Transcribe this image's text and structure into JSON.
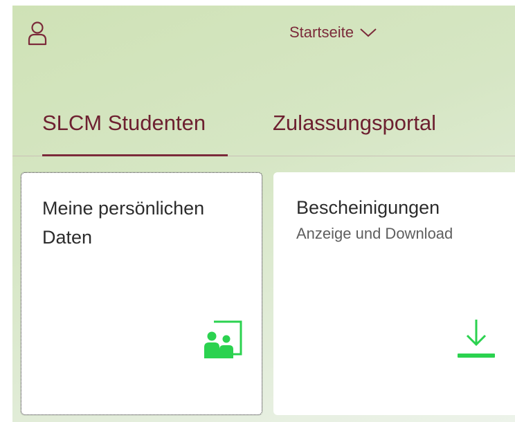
{
  "header": {
    "user_icon": "person-icon",
    "app_title": "Startseite",
    "title_menu_icon": "chevron-down-icon"
  },
  "tabs": [
    {
      "label": "SLCM Studenten",
      "selected": true
    },
    {
      "label": "Zulassungsportal",
      "selected": false
    }
  ],
  "tiles": [
    {
      "title": "Meine persönlichen Daten",
      "subtitle": "",
      "icon": "people-presentation-icon"
    },
    {
      "title": "Bescheinigungen",
      "subtitle": "Anzeige und Download",
      "icon": "download-icon"
    }
  ],
  "colors": {
    "brand": "#7b2a3a",
    "icon_green": "#2bd24f",
    "background": "#d6e6c4"
  }
}
